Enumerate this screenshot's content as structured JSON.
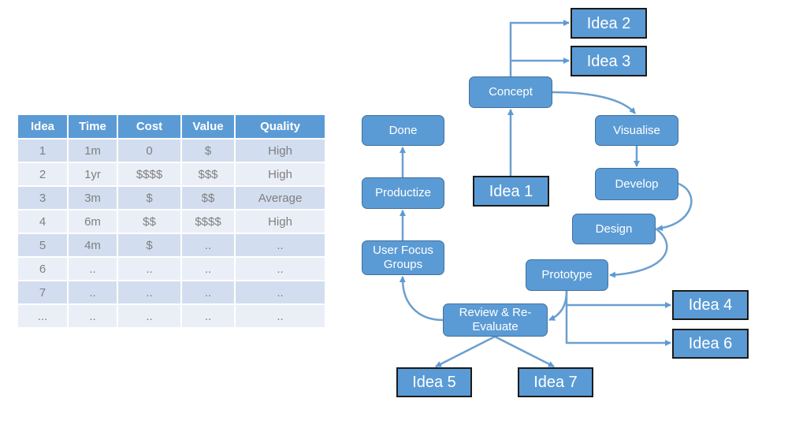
{
  "table": {
    "headers": [
      "Idea",
      "Time",
      "Cost",
      "Value",
      "Quality"
    ],
    "rows": [
      [
        "1",
        "1m",
        "0",
        "$",
        "High"
      ],
      [
        "2",
        "1yr",
        "$$$$",
        "$$$",
        "High"
      ],
      [
        "3",
        "3m",
        "$",
        "$$",
        "Average"
      ],
      [
        "4",
        "6m",
        "$$",
        "$$$$",
        "High"
      ],
      [
        "5",
        "4m",
        "$",
        "..",
        ".."
      ],
      [
        "6",
        "..",
        "..",
        "..",
        ".."
      ],
      [
        "7",
        "..",
        "..",
        "..",
        ".."
      ],
      [
        "...",
        "..",
        "..",
        "..",
        ".."
      ]
    ]
  },
  "diagram": {
    "colors": {
      "node_fill": "#5b9bd5",
      "arrow": "#5b9bd5",
      "idea_border": "#1a1a1a"
    },
    "nodes": {
      "concept": "Concept",
      "visualise": "Visualise",
      "develop": "Develop",
      "design": "Design",
      "prototype": "Prototype",
      "review": "Review & Re-Evaluate",
      "user_focus": "User Focus Groups",
      "productize": "Productize",
      "done": "Done",
      "idea1": "Idea 1",
      "idea2": "Idea 2",
      "idea3": "Idea 3",
      "idea4": "Idea 4",
      "idea5": "Idea 5",
      "idea6": "Idea 6",
      "idea7": "Idea 7"
    },
    "edges": [
      [
        "idea1",
        "concept"
      ],
      [
        "concept",
        "idea2"
      ],
      [
        "concept",
        "idea3"
      ],
      [
        "concept",
        "visualise"
      ],
      [
        "visualise",
        "develop"
      ],
      [
        "develop",
        "design"
      ],
      [
        "design",
        "prototype"
      ],
      [
        "prototype",
        "review"
      ],
      [
        "prototype",
        "idea4"
      ],
      [
        "prototype",
        "idea6"
      ],
      [
        "review",
        "idea5"
      ],
      [
        "review",
        "idea7"
      ],
      [
        "review",
        "user_focus"
      ],
      [
        "user_focus",
        "productize"
      ],
      [
        "productize",
        "done"
      ]
    ]
  }
}
